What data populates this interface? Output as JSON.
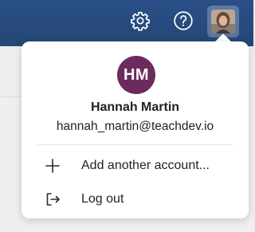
{
  "colors": {
    "topbar": "#2a4f86",
    "avatar_bg": "#6b2b5e",
    "text": "#222222"
  },
  "header": {
    "icons": [
      "gear-icon",
      "help-icon"
    ]
  },
  "account_menu": {
    "avatar_initials": "HM",
    "user_name": "Hannah Martin",
    "user_email": "hannah_martin@teachdev.io",
    "items": [
      {
        "label": "Add another account...",
        "icon": "plus-icon"
      },
      {
        "label": "Log out",
        "icon": "logout-icon"
      }
    ]
  }
}
